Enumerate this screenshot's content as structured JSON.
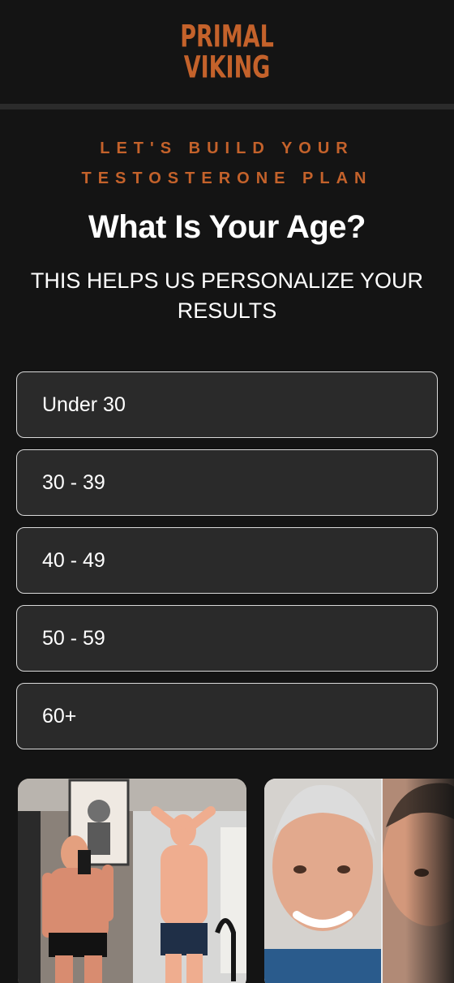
{
  "brand": {
    "logo_line1": "PRIMAL",
    "logo_line2": "VIKING",
    "accent_color": "#c4622b"
  },
  "quiz": {
    "eyebrow_line1": "LET'S BUILD YOUR",
    "eyebrow_line2": "TESTOSTERONE PLAN",
    "question": "What Is Your Age?",
    "subtitle": "THIS HELPS US PERSONALIZE YOUR RESULTS",
    "options": [
      "Under 30",
      "30 - 39",
      "40 - 49",
      "50 - 59",
      "60+"
    ]
  },
  "testimonials": {
    "cards": [
      {
        "icon": "before-after-photo"
      },
      {
        "icon": "before-after-photo"
      }
    ]
  }
}
